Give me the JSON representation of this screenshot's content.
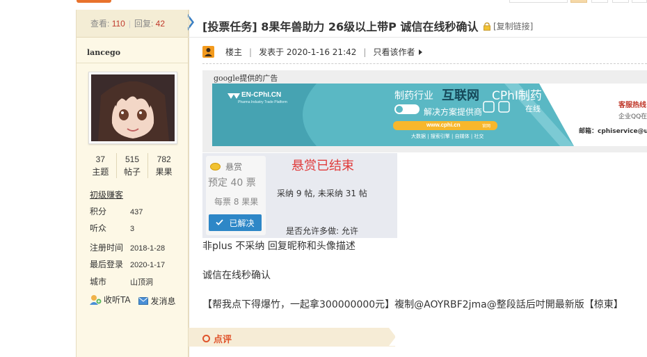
{
  "stats": {
    "views_label": "查看:",
    "views": "110",
    "replies_label": "回复:",
    "replies": "42"
  },
  "user": {
    "name": "lancego",
    "counts": [
      {
        "value": "37",
        "label": "主题"
      },
      {
        "value": "515",
        "label": "帖子"
      },
      {
        "value": "782",
        "label": "果果"
      }
    ],
    "rank": "初级赚客",
    "info": [
      {
        "key": "积分",
        "value": "437"
      },
      {
        "key": "听众",
        "value": "3"
      },
      {
        "key": "注册时间",
        "value": "2018-1-28"
      },
      {
        "key": "最后登录",
        "value": "2020-1-17"
      },
      {
        "key": "城市",
        "value": "山顶洞"
      }
    ],
    "follow_label": "收听TA",
    "message_label": "发消息"
  },
  "thread": {
    "title": "[投票任务] 8果年兽助力 26级以上带P 诚信在线秒确认",
    "copy_link": "[复制链接]"
  },
  "post_header": {
    "author_role": "楼主",
    "posted": "发表于 2020-1-16 21:42",
    "only_author": "只看该作者"
  },
  "ad": {
    "label": "google提供的广告",
    "brand": "EN-CPhI.CN",
    "brand_sub": "Pharma Industry Trade Platform",
    "line1a": "制药行业",
    "line1b": "互联网",
    "cphi": "CPhI制药",
    "online_vertical": "Online",
    "online_cn": "在线",
    "solution": "解决方案提供商",
    "url": "www.cphi.cn",
    "url_tag": "官网",
    "sub_tags": "大数据 | 搜索引擎 | 自媒体 | 社交",
    "hotline": "客服热线",
    "qq": "企业QQ在",
    "email": "邮箱：cphiservice@u"
  },
  "reward": {
    "head": "悬赏",
    "line1": "预定 40 票",
    "line2": "每票 8 果果",
    "solved": "已解决",
    "ended": "悬赏已结束",
    "stat": "采纳 9 帖, 未采纳 31 帖",
    "multi": "是否允许多做:  允许"
  },
  "content": {
    "line1": "非plus      不采纳      回复昵称和头像描述",
    "line2": "诚信在线秒确认",
    "line3": "【帮我点下得爆竹，一起拿300000000元】複制@AOYRBF2jma@整段話后吋開最新版【椋東】"
  },
  "rate": {
    "label": "点评"
  },
  "colors": {
    "accent_blue": "#2e87c7",
    "reward_red": "#e03b3b",
    "banner": "#5ab8c4",
    "rate_orange": "#e0532b"
  }
}
